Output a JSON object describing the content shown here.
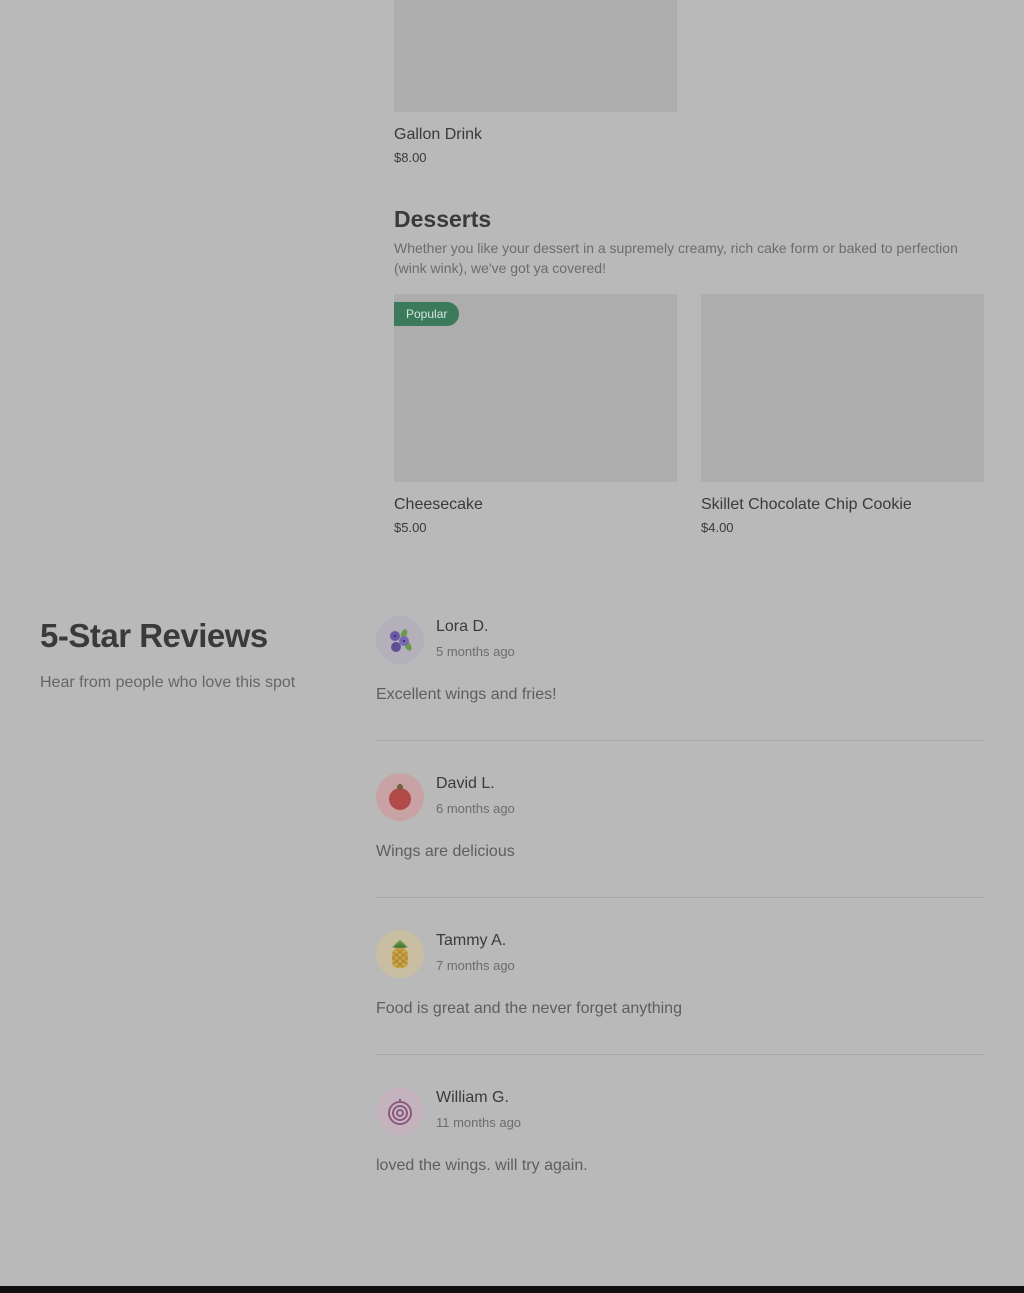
{
  "drinks": {
    "items": [
      {
        "name": "Gallon Drink",
        "price": "$8.00"
      }
    ]
  },
  "desserts": {
    "title": "Desserts",
    "description": "Whether you like your dessert in a supremely creamy, rich cake form or baked to perfection (wink wink), we've got ya covered!",
    "items": [
      {
        "name": "Cheesecake",
        "price": "$5.00",
        "badge": "Popular"
      },
      {
        "name": "Skillet Chocolate Chip Cookie",
        "price": "$4.00"
      }
    ]
  },
  "reviews": {
    "title": "5-Star Reviews",
    "subtitle": "Hear from people who love this spot",
    "items": [
      {
        "name": "Lora D.",
        "time": "5 months ago",
        "text": "Excellent wings and fries!",
        "avatar_icon": "blueberry-icon",
        "avatar_bg": "#b3b0b9"
      },
      {
        "name": "David L.",
        "time": "6 months ago",
        "text": "Wings are delicious",
        "avatar_icon": "tomato-icon",
        "avatar_bg": "#c9a3a3"
      },
      {
        "name": "Tammy A.",
        "time": "7 months ago",
        "text": "Food is great and the never forget anything",
        "avatar_icon": "pineapple-icon",
        "avatar_bg": "#c9bda2"
      },
      {
        "name": "William G.",
        "time": "11 months ago",
        "text": "loved the wings. will try again.",
        "avatar_icon": "onion-icon",
        "avatar_bg": "#c4b3bd"
      }
    ]
  }
}
